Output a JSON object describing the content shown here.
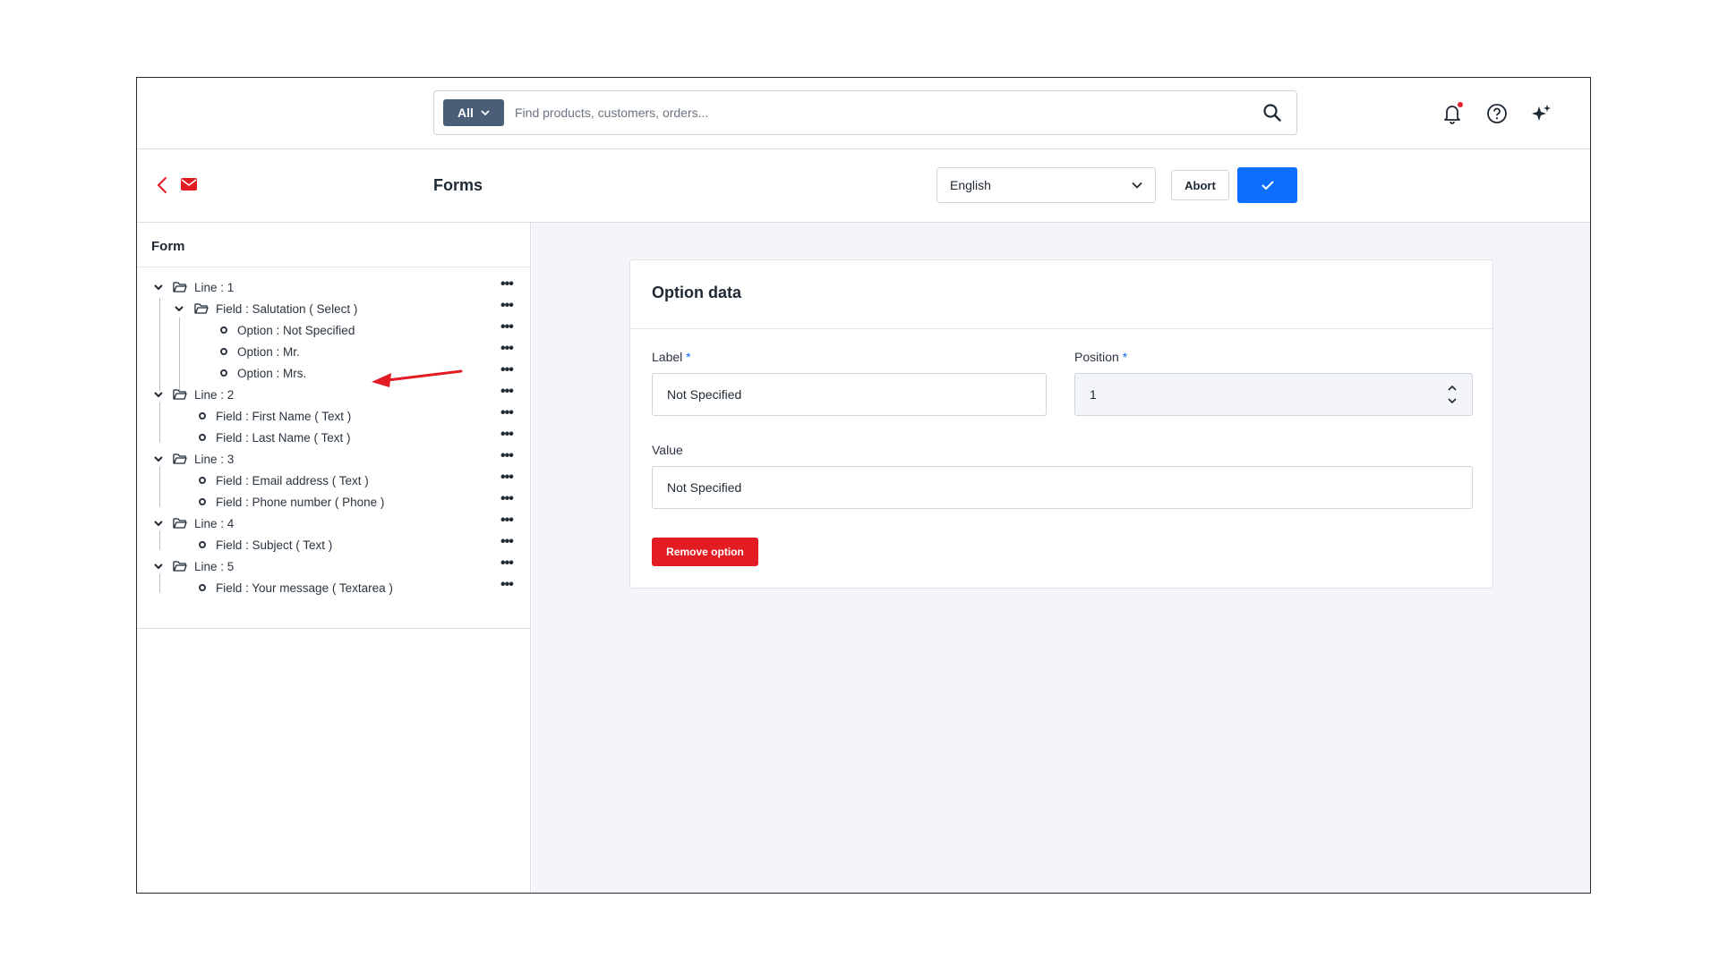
{
  "search": {
    "scope_label": "All",
    "placeholder": "Find products, customers, orders..."
  },
  "toolbar": {
    "title": "Forms",
    "language": "English",
    "abort_label": "Abort"
  },
  "left_panel": {
    "title": "Form",
    "tree": [
      {
        "label": "Line : 1",
        "type": "folder",
        "level": 0
      },
      {
        "label": "Field : Salutation ( Select )",
        "type": "folder",
        "level": 1
      },
      {
        "label": "Option : Not Specified",
        "type": "leaf",
        "level": 2,
        "selected": true
      },
      {
        "label": "Option : Mr.",
        "type": "leaf",
        "level": 2
      },
      {
        "label": "Option : Mrs.",
        "type": "leaf",
        "level": 2
      },
      {
        "label": "Line : 2",
        "type": "folder",
        "level": 0
      },
      {
        "label": "Field : First Name ( Text )",
        "type": "leaf",
        "level": 1
      },
      {
        "label": "Field : Last Name ( Text )",
        "type": "leaf",
        "level": 1
      },
      {
        "label": "Line : 3",
        "type": "folder",
        "level": 0
      },
      {
        "label": "Field : Email address ( Text )",
        "type": "leaf",
        "level": 1
      },
      {
        "label": "Field : Phone number ( Phone )",
        "type": "leaf",
        "level": 1
      },
      {
        "label": "Line : 4",
        "type": "folder",
        "level": 0
      },
      {
        "label": "Field : Subject ( Text )",
        "type": "leaf",
        "level": 1
      },
      {
        "label": "Line : 5",
        "type": "folder",
        "level": 0
      },
      {
        "label": "Field : Your message ( Textarea )",
        "type": "leaf",
        "level": 1
      }
    ]
  },
  "option_card": {
    "title": "Option data",
    "label_field": {
      "label": "Label",
      "required_mark": "*",
      "value": "Not Specified"
    },
    "position_field": {
      "label": "Position",
      "required_mark": "*",
      "value": "1"
    },
    "value_field": {
      "label": "Value",
      "value": "Not Specified"
    },
    "remove_label": "Remove option"
  },
  "colors": {
    "primary": "#0d6efd",
    "danger": "#e31b23",
    "scope_button": "#4a5e78"
  }
}
